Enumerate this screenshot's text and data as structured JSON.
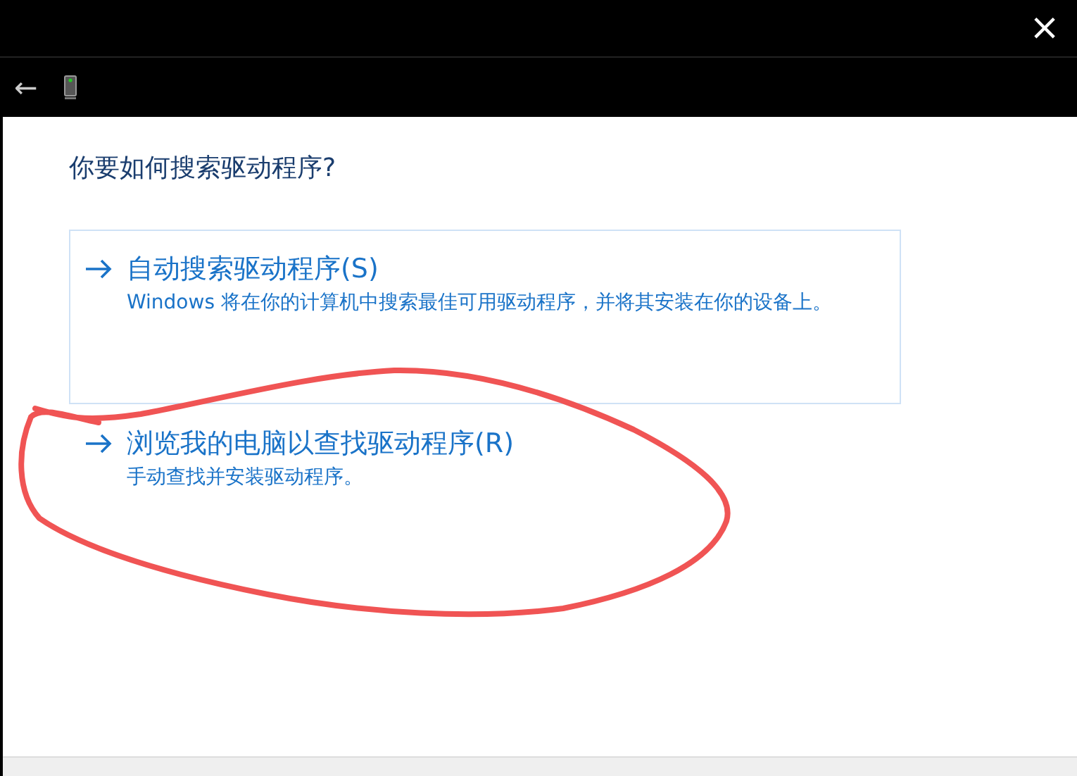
{
  "window": {
    "close_glyph": "×"
  },
  "nav": {
    "back_glyph": "←"
  },
  "heading": "你要如何搜索驱动程序?",
  "options": [
    {
      "title": "自动搜索驱动程序(S)",
      "description": "Windows 将在你的计算机中搜索最佳可用驱动程序，并将其安装在你的设备上。",
      "selected": true
    },
    {
      "title": "浏览我的电脑以查找驱动程序(R)",
      "description": "手动查找并安装驱动程序。",
      "selected": false
    }
  ]
}
